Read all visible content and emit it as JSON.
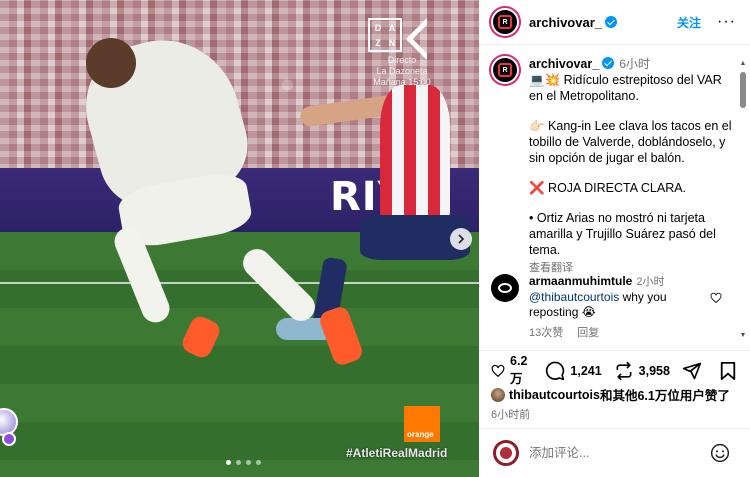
{
  "media": {
    "broadcaster_name": "DAZN",
    "broadcast_line1": "Directo",
    "broadcast_line2": "La Dazoneta",
    "broadcast_line3": "Mañana 15:00",
    "banner_text": "RIYA",
    "sponsor": "orange",
    "hashtag": "#AtletiRealMadrid",
    "carousel_dots": 4,
    "carousel_active": 1
  },
  "header": {
    "username": "archivovar_",
    "follow_label": "关注",
    "more_label": "···"
  },
  "caption": {
    "username": "archivovar_",
    "time": "6小时",
    "line1": "💻💥 Ridículo estrepitoso del VAR en el Metropolitano.",
    "line2": "👉🏻 Kang-in Lee clava los tacos en el tobillo de Valverde, doblándoselo, y sin opción de jugar el balón.",
    "line3": "❌ ROJA DIRECTA CLARA.",
    "line4": "• Ortiz Arias no mostró ni tarjeta amarilla y Trujillo Suárez pasó del tema.",
    "translate": "查看翻译"
  },
  "comment": {
    "username": "armaanmuhimtule",
    "time": "2小时",
    "mention": "@thibautcourtois",
    "text": " why you reposting 😭",
    "likes": "13次赞",
    "reply": "回复"
  },
  "actions": {
    "likes_count": "6.2 万",
    "comments_count": "1,241",
    "reposts_count": "3,958"
  },
  "liked_by": {
    "user": "thibautcourtois",
    "rest": "和其他6.1万位用户赞了"
  },
  "date": "6小时前",
  "add_comment": {
    "placeholder": "添加评论..."
  },
  "colors": {
    "accent": "#0095f6",
    "muted": "#737373",
    "verified": "#0095f6"
  }
}
